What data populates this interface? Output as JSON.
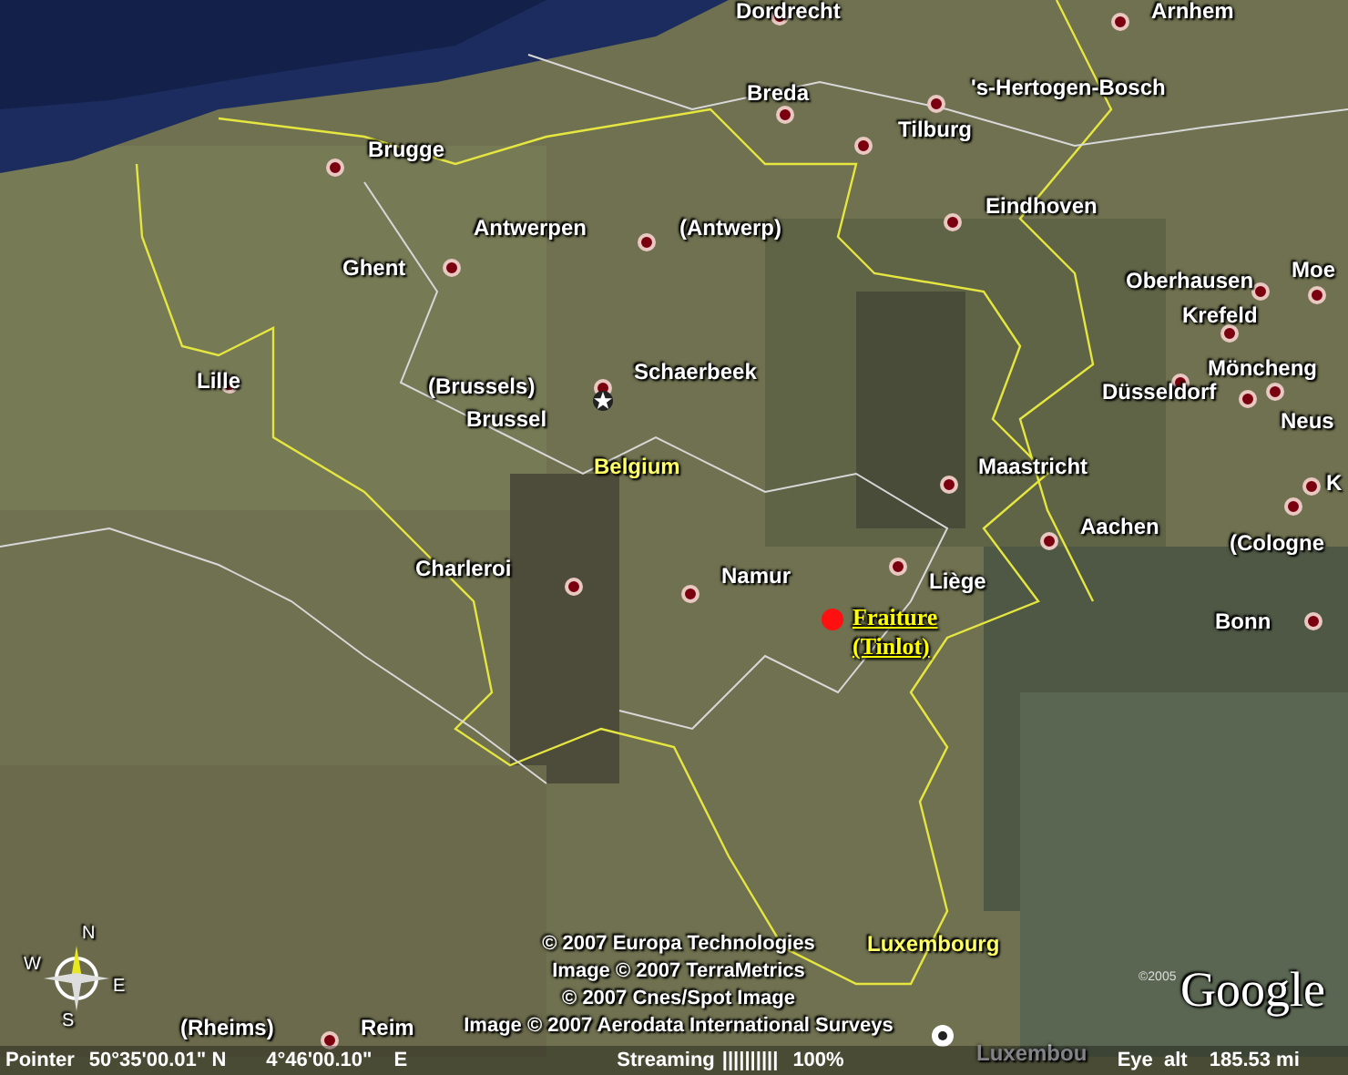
{
  "places": [
    {
      "kind": "city",
      "name": "Dordrecht"
    },
    {
      "kind": "city",
      "name": "Arnhem"
    },
    {
      "kind": "city",
      "name": "Breda"
    },
    {
      "kind": "city",
      "name": "'s-Hertogen-Bosch"
    },
    {
      "kind": "city",
      "name": "Tilburg"
    },
    {
      "kind": "city",
      "name": "Brugge"
    },
    {
      "kind": "city",
      "name": "Eindhoven"
    },
    {
      "kind": "city",
      "name": "Antwerpen"
    },
    {
      "kind": "city",
      "name": "(Antwerp)"
    },
    {
      "kind": "city",
      "name": "Ghent"
    },
    {
      "kind": "city",
      "name": "Oberhausen"
    },
    {
      "kind": "city",
      "name": "Moe"
    },
    {
      "kind": "city",
      "name": "Krefeld"
    },
    {
      "kind": "city",
      "name": "Düsseldorf"
    },
    {
      "kind": "city",
      "name": "Schaerbeek"
    },
    {
      "kind": "city",
      "name": "Möncheng"
    },
    {
      "kind": "city",
      "name": "Lille"
    },
    {
      "kind": "city",
      "name": "(Brussels)"
    },
    {
      "kind": "capital",
      "name": "Brussel"
    },
    {
      "kind": "city",
      "name": "Neus"
    },
    {
      "kind": "country",
      "name": "Belgium"
    },
    {
      "kind": "city",
      "name": "Maastricht"
    },
    {
      "kind": "city",
      "name": "K"
    },
    {
      "kind": "city",
      "name": "Aachen"
    },
    {
      "kind": "city",
      "name": "(Cologne"
    },
    {
      "kind": "city",
      "name": "Charleroi"
    },
    {
      "kind": "city",
      "name": "Namur"
    },
    {
      "kind": "city",
      "name": "Liège"
    },
    {
      "kind": "placemark",
      "lines": [
        "Fraiture",
        "(Tinlot)"
      ]
    },
    {
      "kind": "city",
      "name": "Bonn"
    },
    {
      "kind": "country",
      "name": "Luxembourg"
    },
    {
      "kind": "city",
      "name": "(Rheims)"
    },
    {
      "kind": "city",
      "name": "Reim"
    },
    {
      "kind": "faded",
      "name": "Luxembou"
    }
  ],
  "copyright": [
    "© 2007 Europa Technologies",
    "Image © 2007 TerraMetrics",
    "© 2007 Cnes/Spot Image",
    "Image © 2007 Aerodata International Surveys"
  ],
  "compass": {
    "north": "N",
    "west": "W",
    "east": "E",
    "south": "S"
  },
  "logo": {
    "year": "©2005",
    "name": "Google"
  },
  "status_bar": {
    "pointer_label": "Pointer",
    "latitude": "50°35'00.01\" N",
    "longitude": "4°46'00.10\"",
    "longitude_hemisphere": "E",
    "streaming_label": "Streaming",
    "streaming_bars": "||||||||||",
    "streaming_percent": "100%",
    "eye_alt_label": "Eye  alt",
    "eye_alt": "185.53 mi"
  }
}
